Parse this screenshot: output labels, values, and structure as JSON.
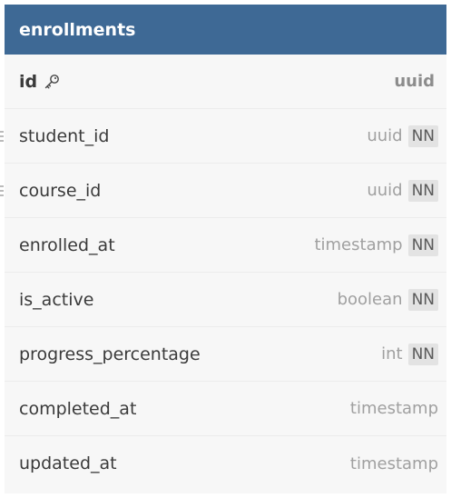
{
  "table": {
    "name": "enrollments",
    "header_color": "#3e6995",
    "columns": [
      {
        "name": "id",
        "type": "uuid",
        "nn": "",
        "primary_key": true
      },
      {
        "name": "student_id",
        "type": "uuid",
        "nn": "NN",
        "relation": true
      },
      {
        "name": "course_id",
        "type": "uuid",
        "nn": "NN",
        "relation": true
      },
      {
        "name": "enrolled_at",
        "type": "timestamp",
        "nn": "NN"
      },
      {
        "name": "is_active",
        "type": "boolean",
        "nn": "NN"
      },
      {
        "name": "progress_percentage",
        "type": "int",
        "nn": "NN"
      },
      {
        "name": "completed_at",
        "type": "timestamp",
        "nn": ""
      },
      {
        "name": "updated_at",
        "type": "timestamp",
        "nn": ""
      }
    ]
  },
  "icons": {
    "primary_key": "key-icon",
    "relation": "relation-connector-icon"
  }
}
